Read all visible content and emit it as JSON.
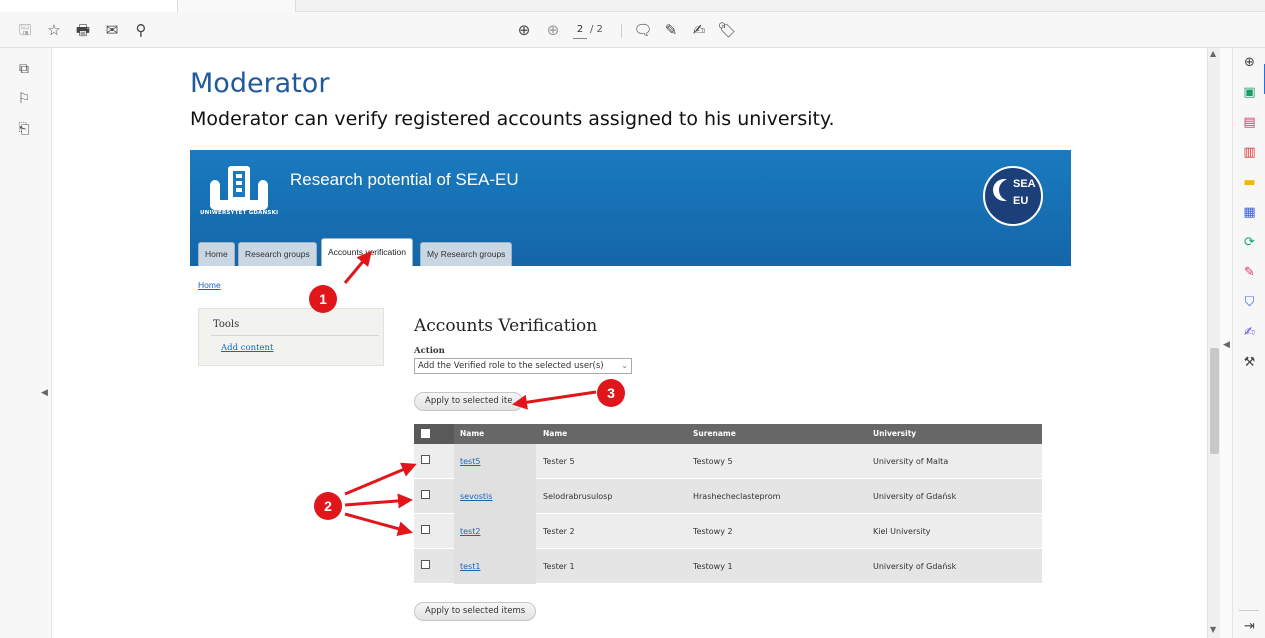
{
  "viewer": {
    "page_current": "2",
    "page_total": "/ 2"
  },
  "doc": {
    "title": "Moderator",
    "subtitle": "Moderator can verify registered accounts assigned to his university."
  },
  "site": {
    "logo_text": "UNIWERSYTET GDAŃSKI",
    "name": "Research potential of SEA-EU",
    "badge_line1": "SEA",
    "badge_line2": "EU",
    "tabs": [
      "Home",
      "Research groups",
      "Accounts verification",
      "My Research groups"
    ],
    "breadcrumb": "Home",
    "sidebar": {
      "heading": "Tools",
      "link": "Add content"
    },
    "page_heading": "Accounts Verification",
    "action_label": "Action",
    "action_value": "Add the Verified role to the selected user(s)",
    "apply_label": "Apply to selected items",
    "apply_label_top": "Apply to selected ite"
  },
  "table": {
    "headers": [
      "Name",
      "Name",
      "Surename",
      "University"
    ],
    "rows": [
      {
        "login": "test5",
        "name": "Tester 5",
        "surname": "Testowy 5",
        "university": "University of Malta"
      },
      {
        "login": "sevostis",
        "name": "Selodrabrusulosp",
        "surname": "Hrashecheclasteprom",
        "university": "University of Gdańsk"
      },
      {
        "login": "test2",
        "name": "Tester 2",
        "surname": "Testowy 2",
        "university": "Kiel University"
      },
      {
        "login": "test1",
        "name": "Tester 1",
        "surname": "Testowy 1",
        "university": "University of Gdańsk"
      }
    ]
  },
  "annotations": {
    "one": "1",
    "two": "2",
    "three": "3"
  },
  "colors": {
    "accent_blue": "#1f5b9c",
    "banner_blue": "#1a7abf",
    "annotation_red": "#e0161b"
  }
}
